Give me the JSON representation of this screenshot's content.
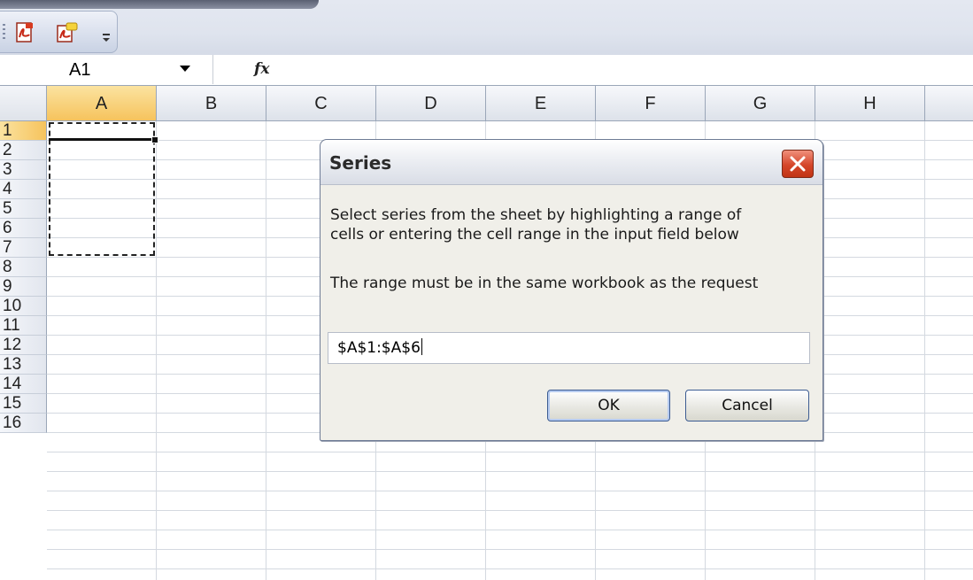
{
  "toolbar": {
    "icons": [
      "pdf-convert-icon",
      "pdf-comment-icon",
      "qat-customize-icon"
    ]
  },
  "formula_bar": {
    "name_box": "A1",
    "fx_label": "fx",
    "formula": ""
  },
  "sheet": {
    "columns": [
      "A",
      "B",
      "C",
      "D",
      "E",
      "F",
      "G",
      "H"
    ],
    "rows": [
      "1",
      "2",
      "3",
      "4",
      "5",
      "6",
      "7",
      "8",
      "9",
      "10",
      "11",
      "12",
      "13",
      "14",
      "15",
      "16"
    ],
    "active_column": "A",
    "active_row": "1",
    "selected_range": "A1:A6"
  },
  "dialog": {
    "title": "Series",
    "message_line1": "Select series from the sheet by highlighting a range of",
    "message_line2": "cells or entering the cell range in the input field below",
    "message_line3": "The range must be in the same workbook as the request",
    "range_value": "$A$1:$A$6",
    "ok_label": "OK",
    "cancel_label": "Cancel"
  },
  "colors": {
    "active_header": "#f6c35d",
    "close_button": "#d5462a",
    "dialog_bg": "#f0efe9"
  }
}
